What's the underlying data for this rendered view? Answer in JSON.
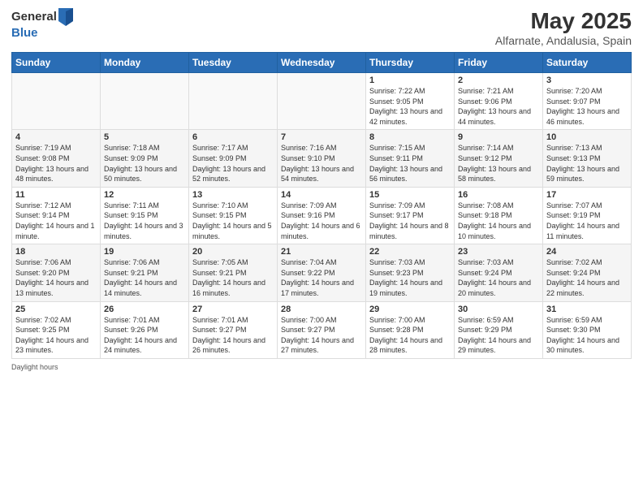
{
  "header": {
    "logo_line1": "General",
    "logo_line2": "Blue",
    "main_title": "May 2025",
    "subtitle": "Alfarnate, Andalusia, Spain"
  },
  "weekdays": [
    "Sunday",
    "Monday",
    "Tuesday",
    "Wednesday",
    "Thursday",
    "Friday",
    "Saturday"
  ],
  "weeks": [
    [
      {
        "day": "",
        "sunrise": "",
        "sunset": "",
        "daylight": ""
      },
      {
        "day": "",
        "sunrise": "",
        "sunset": "",
        "daylight": ""
      },
      {
        "day": "",
        "sunrise": "",
        "sunset": "",
        "daylight": ""
      },
      {
        "day": "",
        "sunrise": "",
        "sunset": "",
        "daylight": ""
      },
      {
        "day": "1",
        "sunrise": "Sunrise: 7:22 AM",
        "sunset": "Sunset: 9:05 PM",
        "daylight": "Daylight: 13 hours and 42 minutes."
      },
      {
        "day": "2",
        "sunrise": "Sunrise: 7:21 AM",
        "sunset": "Sunset: 9:06 PM",
        "daylight": "Daylight: 13 hours and 44 minutes."
      },
      {
        "day": "3",
        "sunrise": "Sunrise: 7:20 AM",
        "sunset": "Sunset: 9:07 PM",
        "daylight": "Daylight: 13 hours and 46 minutes."
      }
    ],
    [
      {
        "day": "4",
        "sunrise": "Sunrise: 7:19 AM",
        "sunset": "Sunset: 9:08 PM",
        "daylight": "Daylight: 13 hours and 48 minutes."
      },
      {
        "day": "5",
        "sunrise": "Sunrise: 7:18 AM",
        "sunset": "Sunset: 9:09 PM",
        "daylight": "Daylight: 13 hours and 50 minutes."
      },
      {
        "day": "6",
        "sunrise": "Sunrise: 7:17 AM",
        "sunset": "Sunset: 9:09 PM",
        "daylight": "Daylight: 13 hours and 52 minutes."
      },
      {
        "day": "7",
        "sunrise": "Sunrise: 7:16 AM",
        "sunset": "Sunset: 9:10 PM",
        "daylight": "Daylight: 13 hours and 54 minutes."
      },
      {
        "day": "8",
        "sunrise": "Sunrise: 7:15 AM",
        "sunset": "Sunset: 9:11 PM",
        "daylight": "Daylight: 13 hours and 56 minutes."
      },
      {
        "day": "9",
        "sunrise": "Sunrise: 7:14 AM",
        "sunset": "Sunset: 9:12 PM",
        "daylight": "Daylight: 13 hours and 58 minutes."
      },
      {
        "day": "10",
        "sunrise": "Sunrise: 7:13 AM",
        "sunset": "Sunset: 9:13 PM",
        "daylight": "Daylight: 13 hours and 59 minutes."
      }
    ],
    [
      {
        "day": "11",
        "sunrise": "Sunrise: 7:12 AM",
        "sunset": "Sunset: 9:14 PM",
        "daylight": "Daylight: 14 hours and 1 minute."
      },
      {
        "day": "12",
        "sunrise": "Sunrise: 7:11 AM",
        "sunset": "Sunset: 9:15 PM",
        "daylight": "Daylight: 14 hours and 3 minutes."
      },
      {
        "day": "13",
        "sunrise": "Sunrise: 7:10 AM",
        "sunset": "Sunset: 9:15 PM",
        "daylight": "Daylight: 14 hours and 5 minutes."
      },
      {
        "day": "14",
        "sunrise": "Sunrise: 7:09 AM",
        "sunset": "Sunset: 9:16 PM",
        "daylight": "Daylight: 14 hours and 6 minutes."
      },
      {
        "day": "15",
        "sunrise": "Sunrise: 7:09 AM",
        "sunset": "Sunset: 9:17 PM",
        "daylight": "Daylight: 14 hours and 8 minutes."
      },
      {
        "day": "16",
        "sunrise": "Sunrise: 7:08 AM",
        "sunset": "Sunset: 9:18 PM",
        "daylight": "Daylight: 14 hours and 10 minutes."
      },
      {
        "day": "17",
        "sunrise": "Sunrise: 7:07 AM",
        "sunset": "Sunset: 9:19 PM",
        "daylight": "Daylight: 14 hours and 11 minutes."
      }
    ],
    [
      {
        "day": "18",
        "sunrise": "Sunrise: 7:06 AM",
        "sunset": "Sunset: 9:20 PM",
        "daylight": "Daylight: 14 hours and 13 minutes."
      },
      {
        "day": "19",
        "sunrise": "Sunrise: 7:06 AM",
        "sunset": "Sunset: 9:21 PM",
        "daylight": "Daylight: 14 hours and 14 minutes."
      },
      {
        "day": "20",
        "sunrise": "Sunrise: 7:05 AM",
        "sunset": "Sunset: 9:21 PM",
        "daylight": "Daylight: 14 hours and 16 minutes."
      },
      {
        "day": "21",
        "sunrise": "Sunrise: 7:04 AM",
        "sunset": "Sunset: 9:22 PM",
        "daylight": "Daylight: 14 hours and 17 minutes."
      },
      {
        "day": "22",
        "sunrise": "Sunrise: 7:03 AM",
        "sunset": "Sunset: 9:23 PM",
        "daylight": "Daylight: 14 hours and 19 minutes."
      },
      {
        "day": "23",
        "sunrise": "Sunrise: 7:03 AM",
        "sunset": "Sunset: 9:24 PM",
        "daylight": "Daylight: 14 hours and 20 minutes."
      },
      {
        "day": "24",
        "sunrise": "Sunrise: 7:02 AM",
        "sunset": "Sunset: 9:24 PM",
        "daylight": "Daylight: 14 hours and 22 minutes."
      }
    ],
    [
      {
        "day": "25",
        "sunrise": "Sunrise: 7:02 AM",
        "sunset": "Sunset: 9:25 PM",
        "daylight": "Daylight: 14 hours and 23 minutes."
      },
      {
        "day": "26",
        "sunrise": "Sunrise: 7:01 AM",
        "sunset": "Sunset: 9:26 PM",
        "daylight": "Daylight: 14 hours and 24 minutes."
      },
      {
        "day": "27",
        "sunrise": "Sunrise: 7:01 AM",
        "sunset": "Sunset: 9:27 PM",
        "daylight": "Daylight: 14 hours and 26 minutes."
      },
      {
        "day": "28",
        "sunrise": "Sunrise: 7:00 AM",
        "sunset": "Sunset: 9:27 PM",
        "daylight": "Daylight: 14 hours and 27 minutes."
      },
      {
        "day": "29",
        "sunrise": "Sunrise: 7:00 AM",
        "sunset": "Sunset: 9:28 PM",
        "daylight": "Daylight: 14 hours and 28 minutes."
      },
      {
        "day": "30",
        "sunrise": "Sunrise: 6:59 AM",
        "sunset": "Sunset: 9:29 PM",
        "daylight": "Daylight: 14 hours and 29 minutes."
      },
      {
        "day": "31",
        "sunrise": "Sunrise: 6:59 AM",
        "sunset": "Sunset: 9:30 PM",
        "daylight": "Daylight: 14 hours and 30 minutes."
      }
    ]
  ],
  "footer": {
    "daylight_label": "Daylight hours"
  }
}
